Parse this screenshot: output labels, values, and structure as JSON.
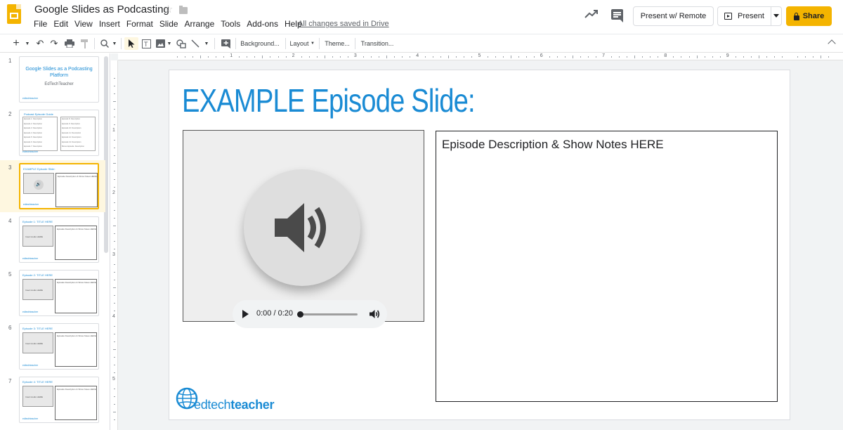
{
  "app": {
    "title": "Google Slides as Podcasting",
    "save_status": "All changes saved in Drive",
    "menu": [
      "File",
      "Edit",
      "View",
      "Insert",
      "Format",
      "Slide",
      "Arrange",
      "Tools",
      "Add-ons",
      "Help"
    ],
    "buttons": {
      "present_remote": "Present w/ Remote",
      "present": "Present",
      "share": "Share"
    },
    "accent_color": "#f4b400"
  },
  "toolbar": {
    "background": "Background...",
    "layout": "Layout",
    "theme": "Theme...",
    "transition": "Transition..."
  },
  "ruler": {
    "top": [
      "1",
      "2",
      "3",
      "4",
      "5",
      "6",
      "7",
      "8",
      "9"
    ],
    "left": [
      "1",
      "2",
      "3",
      "4",
      "5"
    ]
  },
  "filmstrip": {
    "slides": [
      {
        "number": "1",
        "title": "Google Slides as a Podcasting Platform",
        "subtitle": "EdTechTeacher"
      },
      {
        "number": "2",
        "title": "Podcast Episode Guide",
        "items": [
          "Episode 1: Description",
          "Episode 2: Description",
          "Episode 3: Description",
          "Episode 4: Description",
          "Episode 5: Description",
          "Episode 6: Description",
          "Episode 7: Description",
          "Episode 8: Description",
          "Episode 9: Description",
          "Episode 10: Description",
          "Episode 11: Description",
          "Episode 12: Description",
          "Episode 13: Description",
          "Bonus Episode: Description"
        ]
      },
      {
        "number": "3",
        "title": "EXAMPLE Episode Slide:",
        "notes": "Episode Description & Show Notes HERE"
      },
      {
        "number": "4",
        "title": "Episode 1: TITLE HERE",
        "audio": "Insert Audio HERE",
        "notes": "Episode Description & Show Notes HERE"
      },
      {
        "number": "5",
        "title": "Episode 2: TITLE HERE",
        "audio": "Insert Audio HERE",
        "notes": "Episode Description & Show Notes HERE"
      },
      {
        "number": "6",
        "title": "Episode 3: TITLE HERE",
        "audio": "Insert Audio HERE",
        "notes": "Episode Description & Show Notes HERE"
      },
      {
        "number": "7",
        "title": "Episode 4: TITLE HERE",
        "audio": "Insert Audio HERE",
        "notes": "Episode Description & Show Notes HERE"
      }
    ],
    "brand_small": "edtechteacher"
  },
  "slide": {
    "title": "EXAMPLE Episode Slide:",
    "notes_text": "Episode Description & Show Notes HERE",
    "player": {
      "time": "0:00 / 0:20",
      "progress": 0.0
    },
    "brand": {
      "prefix": "edtech",
      "suffix": "teacher",
      "color": "#1a8bd4"
    }
  }
}
